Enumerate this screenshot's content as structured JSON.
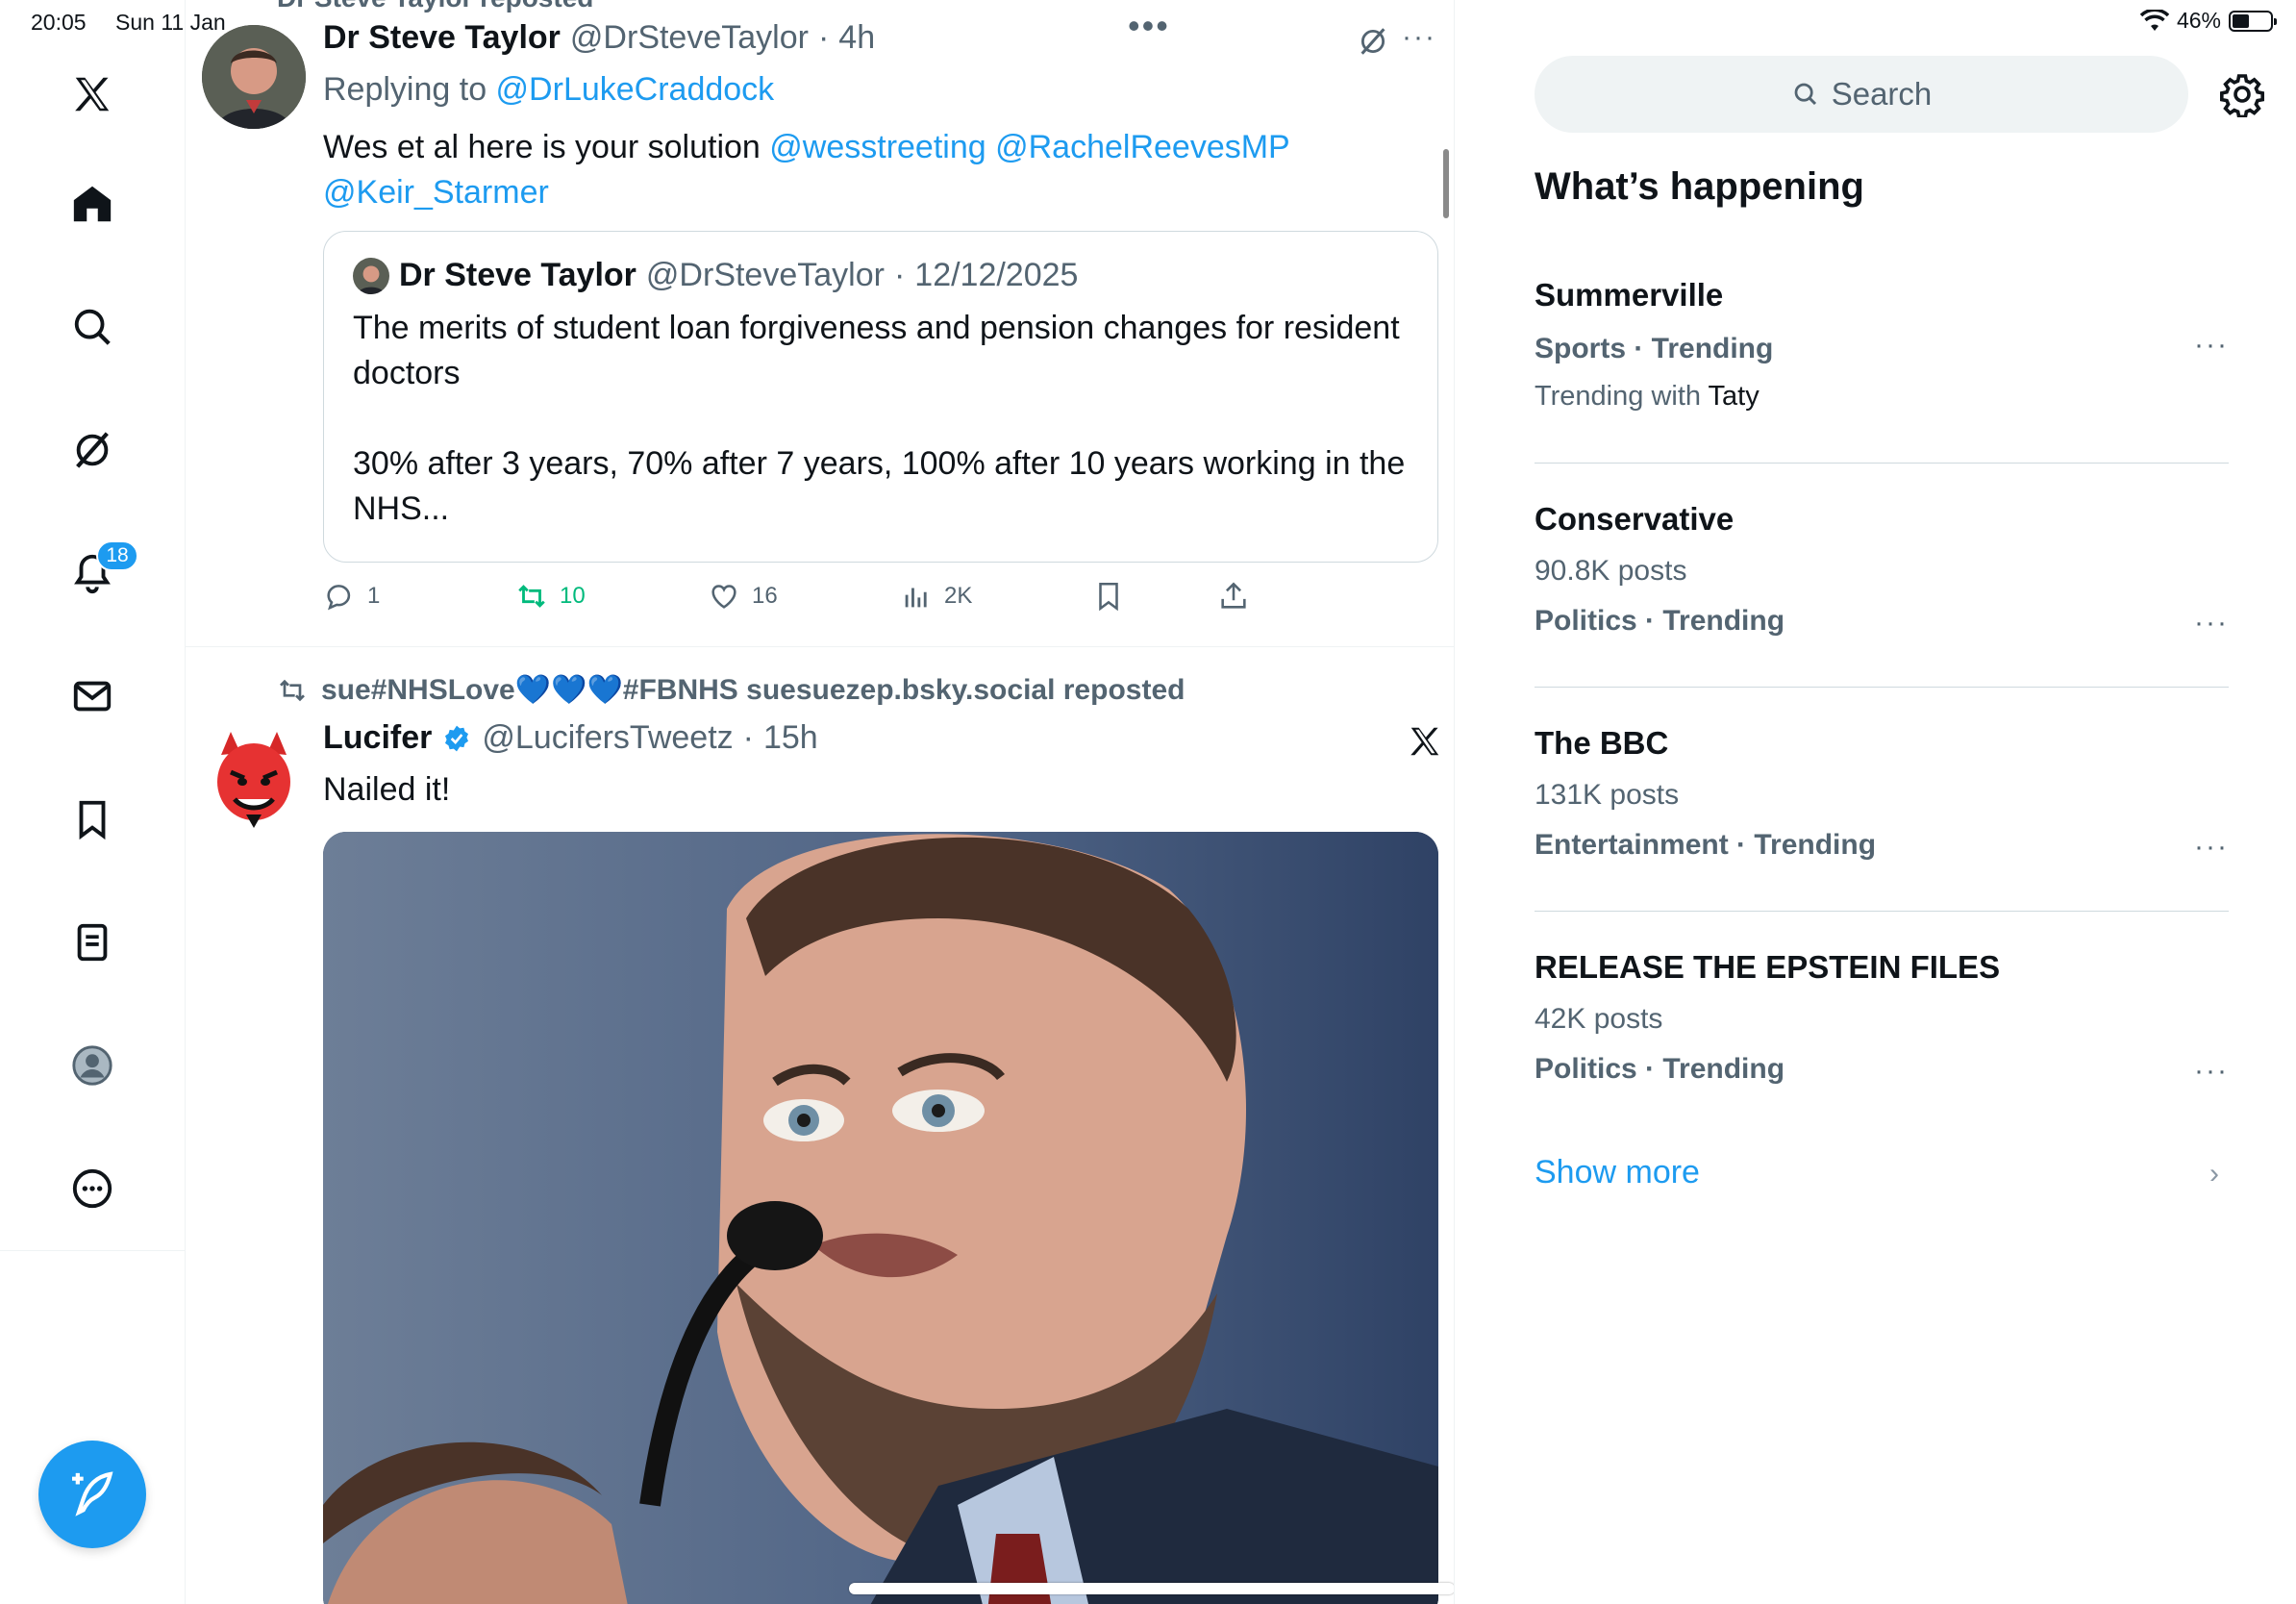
{
  "status": {
    "time": "20:05",
    "date": "Sun 11 Jan",
    "battery": "46%",
    "battery_level": 0.46
  },
  "nav": {
    "items": [
      "x-logo",
      "home",
      "explore",
      "grok",
      "notifications",
      "messages",
      "bookmarks",
      "lists",
      "profile",
      "more"
    ],
    "notifications_badge": "18"
  },
  "timeline": {
    "cut_header": "Dr Steve Taylor reposted",
    "tweet1": {
      "name": "Dr Steve Taylor",
      "handle": "@DrSteveTaylor",
      "sep": "·",
      "time": "4h",
      "replying_prefix": "Replying to ",
      "replying_to": "@DrLukeCraddock",
      "text_prefix": "Wes et al here is your solution ",
      "mentions_line1": "@wesstreeting @RachelReevesMP",
      "mentions_line2": "@Keir_Starmer",
      "quote": {
        "name": "Dr Steve Taylor",
        "handle": "@DrSteveTaylor",
        "sep": "·",
        "date": "12/12/2025",
        "line1": "The merits of student loan forgiveness and pension changes for resident",
        "line2": "doctors",
        "line3": "30% after 3 years, 70% after 7 years, 100% after 10 years working in the",
        "line4": "NHS..."
      },
      "actions": {
        "replies": "1",
        "reposts": "10",
        "likes": "16",
        "views": "2K"
      }
    },
    "tweet2": {
      "repost_line": "sue#NHSLove💙💙💙#FBNHS suesuezep.bsky.social reposted",
      "name": "Lucifer",
      "handle": "@LucifersTweetz",
      "sep": "·",
      "time": "15h",
      "text": "Nailed it!"
    }
  },
  "sidebar": {
    "search_placeholder": "Search",
    "title": "What’s happening",
    "trends": [
      {
        "title": "Summerville",
        "meta": "Sports · Trending",
        "sub_prefix": "Trending with ",
        "sub_name": "Taty"
      },
      {
        "title": "Conservative",
        "posts": "90.8K posts",
        "meta": "Politics · Trending"
      },
      {
        "title": "The BBC",
        "posts": "131K posts",
        "meta": "Entertainment · Trending"
      },
      {
        "title": "RELEASE THE EPSTEIN FILES",
        "posts": "42K posts",
        "meta": "Politics · Trending"
      }
    ],
    "show_more": "Show more",
    "more_dots": "···"
  },
  "colors": {
    "accent": "#1d9bf0",
    "repost_green": "#00ba7c",
    "text_secondary": "#536471"
  }
}
